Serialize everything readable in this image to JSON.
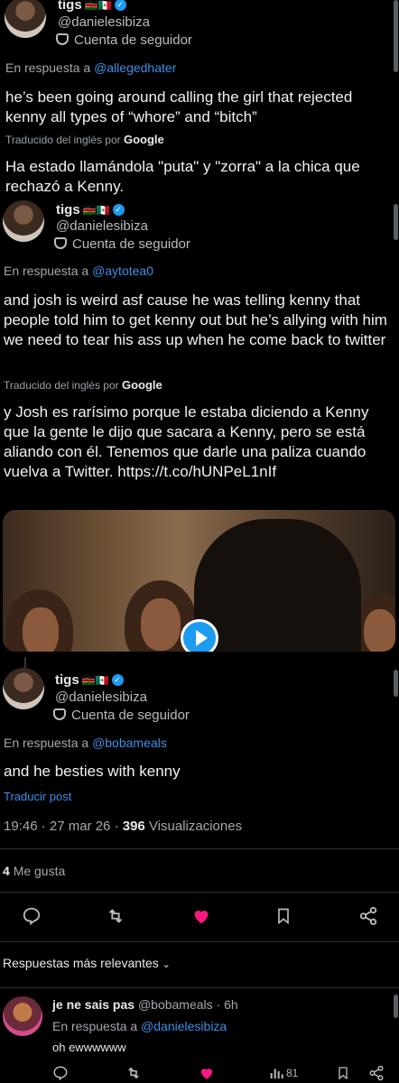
{
  "author": {
    "name": "tigs",
    "flags": "🇰🇪🇲🇽",
    "handle": "@danielesibiza",
    "follower_label": "Cuenta de seguidor"
  },
  "tweets": [
    {
      "reply_prefix": "En respuesta a",
      "reply_to": "@allegedhater",
      "text": "he’s been going around calling the girl that rejected kenny all types of “whore” and “bitch”",
      "translated_prefix": "Traducido del inglés por",
      "translated_by": "Google",
      "translation": "Ha estado llamándola \"puta\" y \"zorra\" a la chica que rechazó a Kenny."
    },
    {
      "reply_prefix": "En respuesta a",
      "reply_to": "@aytotea0",
      "text": "and josh is weird asf cause he was telling kenny that people told him to get kenny out but he’s allying with him we need to tear his ass up when he come back to twitter",
      "translated_prefix": "Traducido del inglés por",
      "translated_by": "Google",
      "translation": "y Josh es rarísimo porque le estaba diciendo a Kenny que la gente le dijo que sacara a Kenny, pero se está aliando con él. Tenemos que darle una paliza cuando vuelva a Twitter. https://t.co/hUNPeL1nIf"
    },
    {
      "reply_prefix": "En respuesta a",
      "reply_to": "@bobameals",
      "text": "and he besties with kenny",
      "translate_link": "Traducir post",
      "timestamp": "19:46 · 27 mar 26 ·",
      "views_count": "396",
      "views_label": "Visualizaciones",
      "likes_count": "4",
      "likes_label": "Me gusta"
    }
  ],
  "replies_filter": "Respuestas más relevantes",
  "reply": {
    "name": "je ne sais pas",
    "handle": "@bobameals · 6h",
    "reply_prefix": "En respuesta a",
    "reply_to": "@danielesibiza",
    "text": "oh ewwwwww",
    "views": "81"
  },
  "colors": {
    "accent": "#1d9bf0",
    "like": "#f91880",
    "background": "#000000"
  },
  "icons": [
    "reply-icon",
    "retweet-icon",
    "like-icon",
    "bookmark-icon",
    "share-icon",
    "views-icon",
    "play-icon",
    "verified-icon"
  ]
}
